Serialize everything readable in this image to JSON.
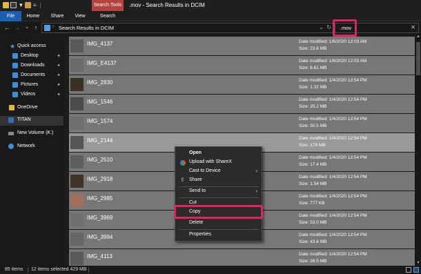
{
  "window": {
    "title": ".mov - Search Results in DCIM",
    "contextual_tab": "Search Tools"
  },
  "ribbon": {
    "tabs": [
      "File",
      "Home",
      "Share",
      "View",
      "Search"
    ]
  },
  "address": {
    "path": "Search Results in DCIM",
    "search_value": ".mov"
  },
  "sidebar": {
    "items": [
      {
        "label": "Quick access",
        "icon": "star-icon"
      },
      {
        "label": "Desktop",
        "icon": "desktop-icon",
        "pinned": true
      },
      {
        "label": "Downloads",
        "icon": "download-icon",
        "pinned": true
      },
      {
        "label": "Documents",
        "icon": "document-icon",
        "pinned": true
      },
      {
        "label": "Pictures",
        "icon": "pictures-icon",
        "pinned": true
      },
      {
        "label": "Videos",
        "icon": "video-icon",
        "pinned": true
      },
      {
        "label": "OneDrive",
        "icon": "onedrive-icon"
      },
      {
        "label": "TITAN",
        "icon": "computer-icon"
      },
      {
        "label": "New Volume (K:)",
        "icon": "drive-icon"
      },
      {
        "label": "Network",
        "icon": "network-icon"
      }
    ]
  },
  "files": [
    {
      "name": "IMG_4137",
      "date": "Date modified: 1/6/2020 12:03 AM",
      "size": "Size: 23.6 MB",
      "thumb": "#5a5a5a"
    },
    {
      "name": "IMG_E4137",
      "date": "Date modified: 1/6/2020 12:03 AM",
      "size": "Size: 6.61 MB",
      "thumb": "#6a6a6a"
    },
    {
      "name": "IMG_2830",
      "date": "Date modified: 1/4/2020 12:54 PM",
      "size": "Size: 1.32 MB",
      "thumb": "#3b3026"
    },
    {
      "name": "IMG_1546",
      "date": "Date modified: 1/4/2020 12:54 PM",
      "size": "Size: 25.2 MB",
      "thumb": "#4a4a4a"
    },
    {
      "name": "IMG_1574",
      "date": "Date modified: 1/4/2020 12:54 PM",
      "size": "Size: 50.5 MB",
      "thumb": "#6e6e6e"
    },
    {
      "name": "IMG_2144",
      "date": "Date modified: 1/4/2020 12:54 PM",
      "size": "Size: 178 MB",
      "thumb": "#555555"
    },
    {
      "name": "IMG_2510",
      "date": "Date modified: 1/4/2020 12:54 PM",
      "size": "Size: 17.4 MB",
      "thumb": "#5e5e5e"
    },
    {
      "name": "IMG_2918",
      "date": "Date modified: 1/4/2020 12:54 PM",
      "size": "Size: 1.54 MB",
      "thumb": "#3d3326"
    },
    {
      "name": "IMG_2985",
      "date": "Date modified: 1/4/2020 12:54 PM",
      "size": "Size: 777 KB",
      "thumb": "#a0705a"
    },
    {
      "name": "IMG_3969",
      "date": "Date modified: 1/4/2020 12:54 PM",
      "size": "Size: 53.0 MB",
      "thumb": "#707070"
    },
    {
      "name": "IMG_3994",
      "date": "Date modified: 1/4/2020 12:54 PM",
      "size": "Size: 43.6 MB",
      "thumb": "#666666"
    },
    {
      "name": "IMG_4113",
      "date": "Date modified: 1/4/2020 12:54 PM",
      "size": "Size: 26.5 MB",
      "thumb": "#5a5a5a"
    }
  ],
  "context_menu": {
    "open": "Open",
    "upload_sharex": "Upload with ShareX",
    "cast": "Cast to Device",
    "share": "Share",
    "send_to": "Send to",
    "cut": "Cut",
    "copy": "Copy",
    "delete": "Delete",
    "properties": "Properties"
  },
  "status": {
    "items": "85 items",
    "selected": "12 items selected  429 MB"
  },
  "colors": {
    "accent": "#1a5fb0",
    "highlight": "#e0245e",
    "search_tools": "#b4433d",
    "row_selected": "#777777"
  }
}
